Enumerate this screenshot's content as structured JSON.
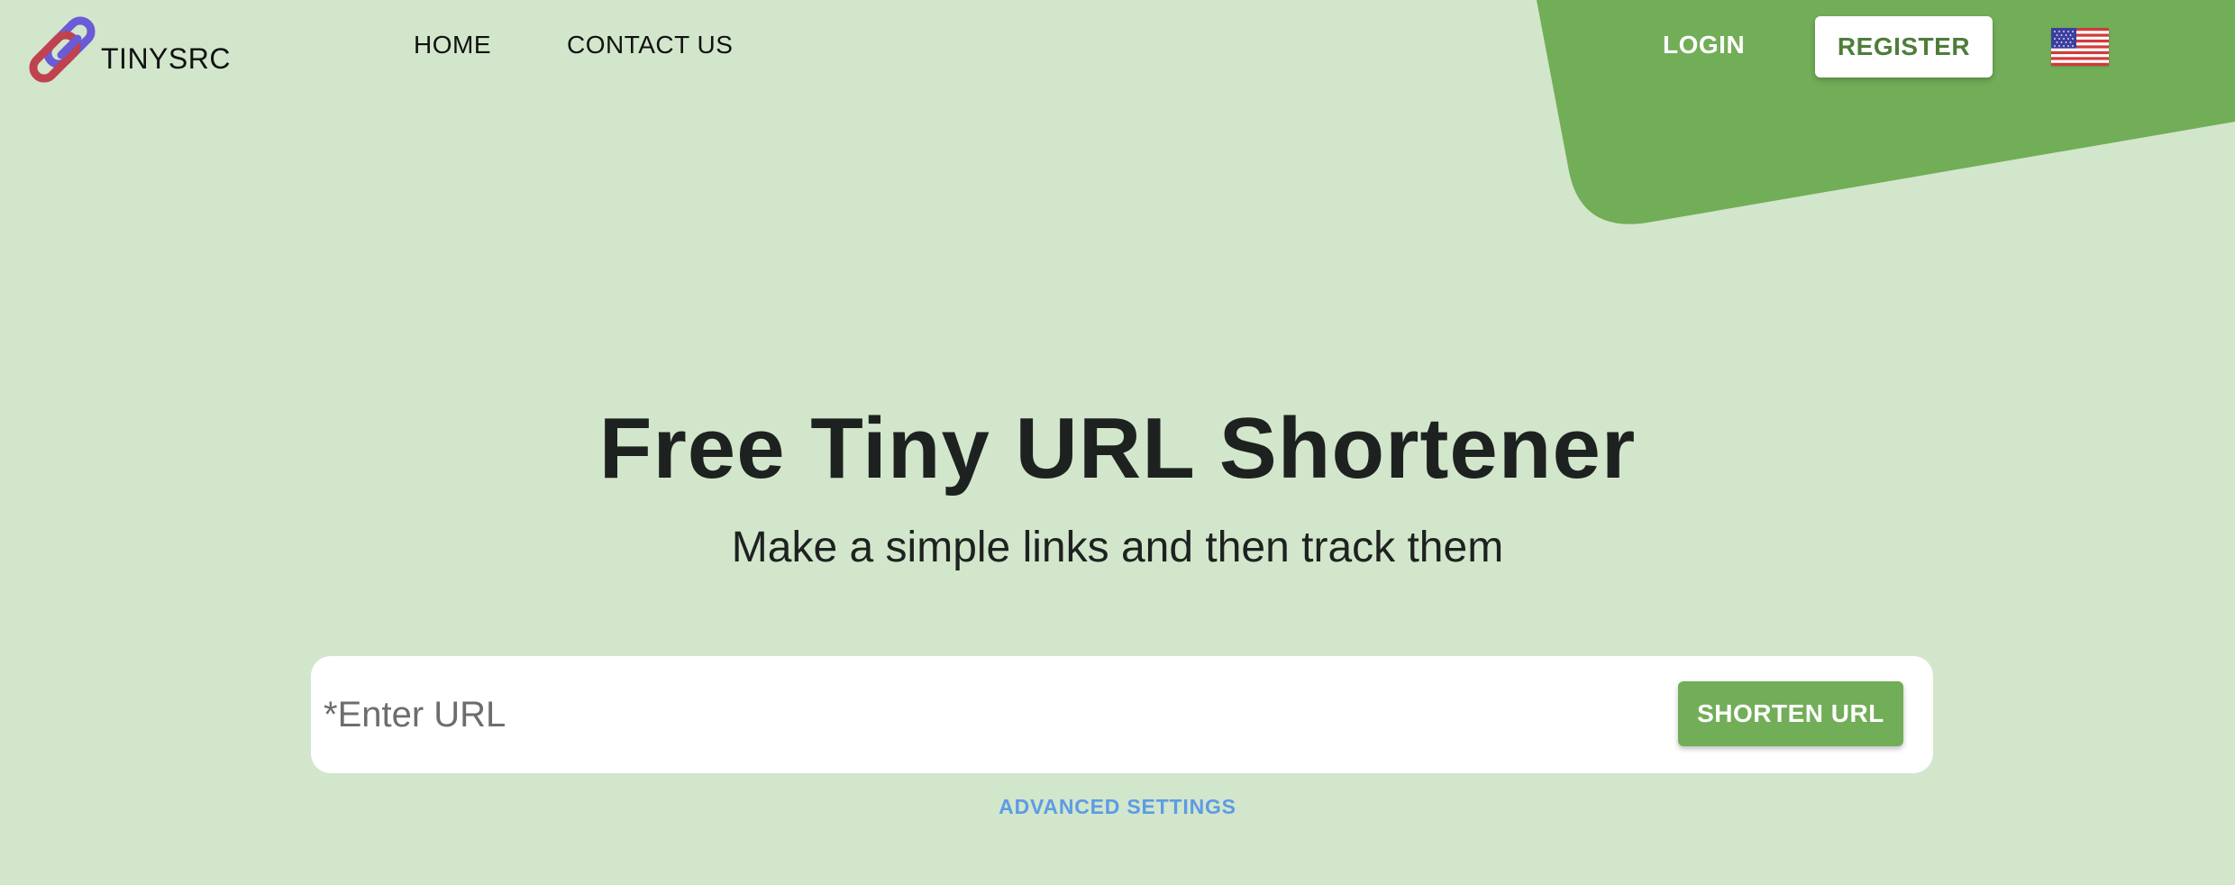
{
  "header": {
    "logo_text": "TINYSRC",
    "logo_icon": "chain-link-icon",
    "nav": {
      "home_label": "HOME",
      "contact_label": "CONTACT US"
    },
    "login_label": "LOGIN",
    "register_label": "REGISTER",
    "language_icon": "us-flag-icon"
  },
  "hero": {
    "title": "Free Tiny URL Shortener",
    "subtitle": "Make a simple links and then track them"
  },
  "shortener": {
    "input_value": "",
    "input_placeholder": "*Enter URL",
    "submit_label": "SHORTEN URL",
    "advanced_label": "ADVANCED SETTINGS"
  },
  "colors": {
    "background": "#d2e6cb",
    "accent_green": "#72ad58",
    "register_text": "#4e7d3a",
    "link_blue": "#5d9be6",
    "logo_purple": "#6a5bd6",
    "logo_red": "#c0424f"
  }
}
